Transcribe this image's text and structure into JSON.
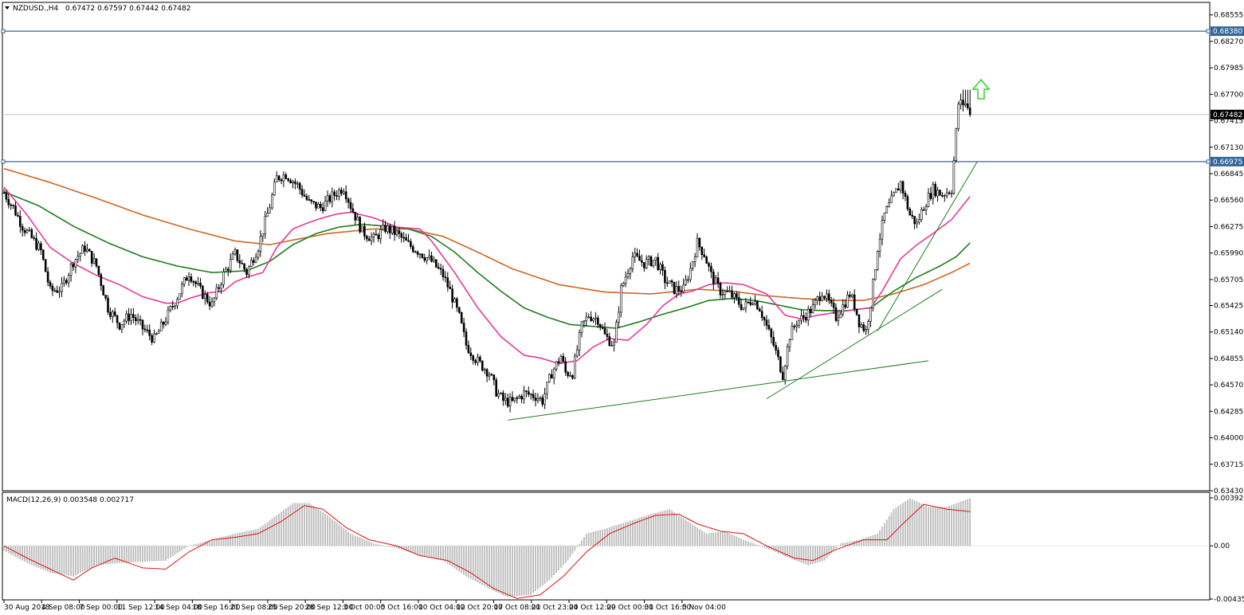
{
  "header": {
    "symbol": "NZDUSD.,H4",
    "ohlc": "0.67472 0.67597 0.67442 0.67482"
  },
  "macd_panel": {
    "label": "MACD(12,26,9) 0.003548 0.002717",
    "ticks": [
      "0.003924",
      "0.00",
      "-0.00435"
    ]
  },
  "price_axis": {
    "ticks": [
      "0.68555",
      "0.68270",
      "0.67985",
      "0.67700",
      "0.67415",
      "0.67130",
      "0.66845",
      "0.66560",
      "0.66275",
      "0.65990",
      "0.65705",
      "0.65425",
      "0.65140",
      "0.64855",
      "0.64570",
      "0.64285",
      "0.64000",
      "0.63715",
      "0.63430"
    ],
    "current_price": "0.67482",
    "resistance_upper": "0.68380",
    "resistance_lower": "0.66975"
  },
  "time_axis": {
    "labels": [
      "30 Aug 2018",
      "4 Sep 08:00",
      "7 Sep 00:00",
      "11 Sep 12:00",
      "14 Sep 04:00",
      "18 Sep 16:00",
      "21 Sep 08:00",
      "25 Sep 20:00",
      "28 Sep 12:00",
      "3 Oct 00:00",
      "5 Oct 16:00",
      "10 Oct 04:00",
      "12 Oct 20:00",
      "17 Oct 08:00",
      "21 Oct 23:00",
      "24 Oct 12:00",
      "29 Oct 00:00",
      "31 Oct 16:00",
      "5 Nov 04:00"
    ]
  },
  "colors": {
    "bull_body": "#ffffff",
    "bear_body": "#000000",
    "hline": "#336699",
    "ma_fast": "#e6399b",
    "ma_mid": "#1e7d1e",
    "ma_slow": "#cc6622",
    "trend": "#1e7d1e",
    "macd_hist": "#bbbbbb",
    "macd_signal": "#dd1111",
    "arrow": "#33cc33"
  },
  "chart_data": {
    "type": "candlestick",
    "symbol": "NZDUSD.,H4",
    "ylim": [
      0.6343,
      0.6869
    ],
    "anchors": [
      [
        0,
        0.6664
      ],
      [
        4,
        0.6648
      ],
      [
        8,
        0.6628
      ],
      [
        12,
        0.6615
      ],
      [
        16,
        0.6601
      ],
      [
        20,
        0.6558
      ],
      [
        25,
        0.6561
      ],
      [
        30,
        0.659
      ],
      [
        35,
        0.6605
      ],
      [
        40,
        0.6585
      ],
      [
        45,
        0.654
      ],
      [
        50,
        0.6522
      ],
      [
        55,
        0.6533
      ],
      [
        60,
        0.6518
      ],
      [
        65,
        0.6506
      ],
      [
        70,
        0.6528
      ],
      [
        75,
        0.6552
      ],
      [
        80,
        0.6578
      ],
      [
        85,
        0.6558
      ],
      [
        90,
        0.6543
      ],
      [
        95,
        0.6576
      ],
      [
        100,
        0.6598
      ],
      [
        105,
        0.6578
      ],
      [
        110,
        0.6606
      ],
      [
        115,
        0.665
      ],
      [
        118,
        0.668
      ],
      [
        122,
        0.6684
      ],
      [
        127,
        0.6672
      ],
      [
        132,
        0.6653
      ],
      [
        137,
        0.6648
      ],
      [
        142,
        0.666
      ],
      [
        147,
        0.667
      ],
      [
        150,
        0.665
      ],
      [
        155,
        0.6622
      ],
      [
        160,
        0.6614
      ],
      [
        165,
        0.6626
      ],
      [
        170,
        0.662
      ],
      [
        175,
        0.6608
      ],
      [
        180,
        0.66
      ],
      [
        185,
        0.659
      ],
      [
        190,
        0.6575
      ],
      [
        193,
        0.6558
      ],
      [
        197,
        0.653
      ],
      [
        200,
        0.65
      ],
      [
        205,
        0.6482
      ],
      [
        210,
        0.647
      ],
      [
        213,
        0.645
      ],
      [
        216,
        0.644
      ],
      [
        220,
        0.6438
      ],
      [
        225,
        0.6448
      ],
      [
        230,
        0.6445
      ],
      [
        233,
        0.644
      ],
      [
        237,
        0.647
      ],
      [
        241,
        0.6488
      ],
      [
        243,
        0.647
      ],
      [
        246,
        0.647
      ],
      [
        250,
        0.652
      ],
      [
        253,
        0.6532
      ],
      [
        257,
        0.6528
      ],
      [
        260,
        0.651
      ],
      [
        264,
        0.65
      ],
      [
        267,
        0.656
      ],
      [
        272,
        0.6595
      ],
      [
        277,
        0.6588
      ],
      [
        282,
        0.6592
      ],
      [
        286,
        0.657
      ],
      [
        290,
        0.656
      ],
      [
        294,
        0.656
      ],
      [
        297,
        0.6582
      ],
      [
        300,
        0.661
      ],
      [
        303,
        0.6598
      ],
      [
        306,
        0.6575
      ],
      [
        310,
        0.6558
      ],
      [
        314,
        0.6555
      ],
      [
        317,
        0.6548
      ],
      [
        320,
        0.654
      ],
      [
        324,
        0.655
      ],
      [
        327,
        0.654
      ],
      [
        330,
        0.652
      ],
      [
        333,
        0.65
      ],
      [
        335,
        0.6484
      ],
      [
        337,
        0.6468
      ],
      [
        340,
        0.651
      ],
      [
        343,
        0.6525
      ],
      [
        346,
        0.653
      ],
      [
        350,
        0.654
      ],
      [
        354,
        0.6558
      ],
      [
        357,
        0.6545
      ],
      [
        360,
        0.653
      ],
      [
        363,
        0.6542
      ],
      [
        366,
        0.6555
      ],
      [
        368,
        0.6543
      ],
      [
        370,
        0.6525
      ],
      [
        373,
        0.6515
      ],
      [
        375,
        0.6545
      ],
      [
        378,
        0.6605
      ],
      [
        381,
        0.664
      ],
      [
        385,
        0.666
      ],
      [
        388,
        0.6675
      ],
      [
        392,
        0.664
      ],
      [
        395,
        0.663
      ],
      [
        398,
        0.665
      ],
      [
        402,
        0.6668
      ],
      [
        406,
        0.6662
      ],
      [
        410,
        0.6668
      ],
      [
        413,
        0.676
      ],
      [
        416,
        0.676
      ],
      [
        418,
        0.6748
      ]
    ],
    "hlines": [
      0.6838,
      0.66975
    ],
    "current": 0.67482,
    "ma_fast": [
      [
        0,
        0.667
      ],
      [
        10,
        0.664
      ],
      [
        20,
        0.6605
      ],
      [
        30,
        0.6588
      ],
      [
        40,
        0.6575
      ],
      [
        50,
        0.6565
      ],
      [
        60,
        0.6552
      ],
      [
        70,
        0.6545
      ],
      [
        75,
        0.6545
      ],
      [
        80,
        0.655
      ],
      [
        88,
        0.6556
      ],
      [
        95,
        0.6558
      ],
      [
        100,
        0.6568
      ],
      [
        105,
        0.6573
      ],
      [
        112,
        0.6578
      ],
      [
        118,
        0.6605
      ],
      [
        125,
        0.6625
      ],
      [
        132,
        0.6632
      ],
      [
        138,
        0.6637
      ],
      [
        144,
        0.6641
      ],
      [
        150,
        0.6643
      ],
      [
        160,
        0.6637
      ],
      [
        170,
        0.6627
      ],
      [
        180,
        0.6625
      ],
      [
        185,
        0.6612
      ],
      [
        195,
        0.6578
      ],
      [
        205,
        0.654
      ],
      [
        215,
        0.6509
      ],
      [
        225,
        0.6489
      ],
      [
        232,
        0.6486
      ],
      [
        240,
        0.648
      ],
      [
        248,
        0.6483
      ],
      [
        255,
        0.6498
      ],
      [
        262,
        0.6507
      ],
      [
        270,
        0.6505
      ],
      [
        278,
        0.6522
      ],
      [
        285,
        0.6542
      ],
      [
        292,
        0.6555
      ],
      [
        298,
        0.6558
      ],
      [
        305,
        0.6565
      ],
      [
        312,
        0.6567
      ],
      [
        320,
        0.6565
      ],
      [
        330,
        0.6555
      ],
      [
        338,
        0.6532
      ],
      [
        345,
        0.6528
      ],
      [
        352,
        0.6532
      ],
      [
        360,
        0.6535
      ],
      [
        368,
        0.6538
      ],
      [
        375,
        0.654
      ],
      [
        380,
        0.6558
      ],
      [
        388,
        0.6593
      ],
      [
        395,
        0.6608
      ],
      [
        402,
        0.662
      ],
      [
        410,
        0.6635
      ],
      [
        418,
        0.666
      ]
    ],
    "ma_mid": [
      [
        0,
        0.6665
      ],
      [
        15,
        0.665
      ],
      [
        30,
        0.6628
      ],
      [
        45,
        0.661
      ],
      [
        60,
        0.6595
      ],
      [
        75,
        0.6585
      ],
      [
        90,
        0.6578
      ],
      [
        105,
        0.658
      ],
      [
        115,
        0.659
      ],
      [
        125,
        0.6608
      ],
      [
        135,
        0.662
      ],
      [
        145,
        0.6627
      ],
      [
        155,
        0.663
      ],
      [
        165,
        0.6628
      ],
      [
        175,
        0.6625
      ],
      [
        185,
        0.6617
      ],
      [
        195,
        0.66
      ],
      [
        205,
        0.6578
      ],
      [
        215,
        0.6558
      ],
      [
        225,
        0.654
      ],
      [
        235,
        0.653
      ],
      [
        245,
        0.6522
      ],
      [
        255,
        0.652
      ],
      [
        265,
        0.6518
      ],
      [
        275,
        0.6525
      ],
      [
        285,
        0.6533
      ],
      [
        295,
        0.654
      ],
      [
        305,
        0.6548
      ],
      [
        315,
        0.655
      ],
      [
        325,
        0.6548
      ],
      [
        335,
        0.6543
      ],
      [
        345,
        0.6538
      ],
      [
        355,
        0.6537
      ],
      [
        365,
        0.6537
      ],
      [
        375,
        0.654
      ],
      [
        385,
        0.6558
      ],
      [
        395,
        0.6573
      ],
      [
        405,
        0.6585
      ],
      [
        412,
        0.6595
      ],
      [
        418,
        0.661
      ]
    ],
    "ma_slow": [
      [
        0,
        0.669
      ],
      [
        20,
        0.6675
      ],
      [
        40,
        0.6658
      ],
      [
        60,
        0.664
      ],
      [
        80,
        0.6625
      ],
      [
        100,
        0.6612
      ],
      [
        115,
        0.6608
      ],
      [
        125,
        0.6613
      ],
      [
        140,
        0.662
      ],
      [
        160,
        0.6625
      ],
      [
        175,
        0.6625
      ],
      [
        190,
        0.6617
      ],
      [
        205,
        0.66
      ],
      [
        220,
        0.6582
      ],
      [
        240,
        0.6565
      ],
      [
        260,
        0.6557
      ],
      [
        280,
        0.6555
      ],
      [
        300,
        0.656
      ],
      [
        315,
        0.6558
      ],
      [
        330,
        0.6553
      ],
      [
        345,
        0.655
      ],
      [
        360,
        0.6548
      ],
      [
        372,
        0.6548
      ],
      [
        385,
        0.6555
      ],
      [
        398,
        0.6565
      ],
      [
        410,
        0.6578
      ],
      [
        418,
        0.6588
      ]
    ],
    "trendlines": [
      [
        [
          218,
          0.6419
        ],
        [
          400,
          0.6483
        ]
      ],
      [
        [
          330,
          0.6442
        ],
        [
          406,
          0.656
        ]
      ],
      [
        [
          378,
          0.6515
        ],
        [
          421,
          0.6697
        ]
      ]
    ],
    "macd": {
      "ylim": [
        -0.00435,
        0.003924
      ],
      "hist": [
        [
          0,
          -0.0004
        ],
        [
          10,
          -0.0014
        ],
        [
          20,
          -0.0022
        ],
        [
          30,
          -0.0025
        ],
        [
          40,
          -0.0016
        ],
        [
          50,
          -0.0014
        ],
        [
          60,
          -0.0013
        ],
        [
          70,
          -0.0012
        ],
        [
          80,
          0.0
        ],
        [
          90,
          0.0005
        ],
        [
          100,
          0.001
        ],
        [
          110,
          0.0014
        ],
        [
          118,
          0.0025
        ],
        [
          125,
          0.0035
        ],
        [
          132,
          0.0035
        ],
        [
          140,
          0.0025
        ],
        [
          150,
          0.001
        ],
        [
          160,
          0.0002
        ],
        [
          170,
          -0.0002
        ],
        [
          180,
          -0.0008
        ],
        [
          190,
          -0.0012
        ],
        [
          200,
          -0.0025
        ],
        [
          210,
          -0.0035
        ],
        [
          218,
          -0.0042
        ],
        [
          228,
          -0.004
        ],
        [
          236,
          -0.0028
        ],
        [
          244,
          -0.0012
        ],
        [
          252,
          0.001
        ],
        [
          260,
          0.0014
        ],
        [
          270,
          0.002
        ],
        [
          280,
          0.0026
        ],
        [
          288,
          0.003
        ],
        [
          296,
          0.002
        ],
        [
          304,
          0.001
        ],
        [
          312,
          0.0012
        ],
        [
          320,
          0.0005
        ],
        [
          330,
          -0.0002
        ],
        [
          340,
          -0.001
        ],
        [
          348,
          -0.0016
        ],
        [
          355,
          -0.0012
        ],
        [
          362,
          0.0002
        ],
        [
          370,
          0.0005
        ],
        [
          378,
          0.001
        ],
        [
          385,
          0.003
        ],
        [
          392,
          0.0039
        ],
        [
          400,
          0.0032
        ],
        [
          408,
          0.0032
        ],
        [
          418,
          0.0039
        ]
      ],
      "signal": [
        [
          0,
          0.0
        ],
        [
          10,
          -0.001
        ],
        [
          20,
          -0.0019
        ],
        [
          30,
          -0.0028
        ],
        [
          38,
          -0.0018
        ],
        [
          48,
          -0.001
        ],
        [
          60,
          -0.0018
        ],
        [
          70,
          -0.0019
        ],
        [
          80,
          -0.0005
        ],
        [
          90,
          0.0005
        ],
        [
          100,
          0.0007
        ],
        [
          110,
          0.001
        ],
        [
          120,
          0.002
        ],
        [
          130,
          0.0033
        ],
        [
          138,
          0.003
        ],
        [
          148,
          0.0015
        ],
        [
          158,
          0.0005
        ],
        [
          170,
          0.0
        ],
        [
          180,
          -0.0008
        ],
        [
          192,
          -0.0012
        ],
        [
          202,
          -0.0022
        ],
        [
          212,
          -0.0035
        ],
        [
          222,
          -0.0043
        ],
        [
          232,
          -0.004
        ],
        [
          242,
          -0.0025
        ],
        [
          252,
          -0.0005
        ],
        [
          262,
          0.001
        ],
        [
          272,
          0.0018
        ],
        [
          282,
          0.0025
        ],
        [
          292,
          0.0026
        ],
        [
          300,
          0.0018
        ],
        [
          310,
          0.0012
        ],
        [
          320,
          0.001
        ],
        [
          330,
          0.0
        ],
        [
          342,
          -0.001
        ],
        [
          350,
          -0.0012
        ],
        [
          360,
          -0.0003
        ],
        [
          372,
          0.0005
        ],
        [
          382,
          0.0005
        ],
        [
          390,
          0.002
        ],
        [
          398,
          0.0034
        ],
        [
          408,
          0.003
        ],
        [
          418,
          0.0028
        ]
      ]
    }
  }
}
